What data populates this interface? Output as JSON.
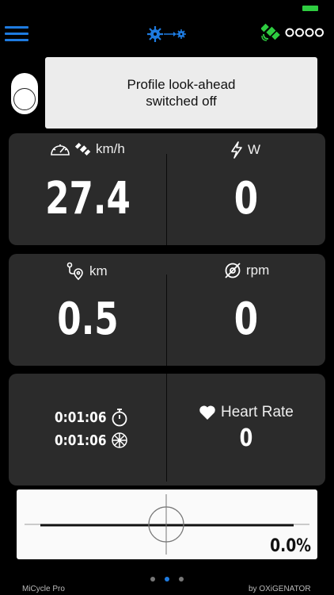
{
  "colors": {
    "accent": "#1e7be0",
    "gps": "#2ecc40",
    "panel": "#2b2b2b",
    "background": "#000000"
  },
  "status": {
    "battery_color": "#2ecc40"
  },
  "header": {
    "menu_icon": "hamburger-icon",
    "center_icon": "chainring-gear-icon",
    "gps_icon": "satellite-icon",
    "sensor_icon": "sensor-dots-icon"
  },
  "profile": {
    "switch_state": "off",
    "message_line1": "Profile look-ahead",
    "message_line2": "switched off"
  },
  "speed": {
    "unit": "km/h",
    "value": "27.4"
  },
  "power": {
    "unit": "W",
    "value": "0"
  },
  "distance": {
    "unit": "km",
    "value": "0.5"
  },
  "cadence": {
    "unit": "rpm",
    "value": "0"
  },
  "times": {
    "total": "0:01:06",
    "moving": "0:01:06"
  },
  "heart_rate": {
    "label": "Heart Rate",
    "value": "0"
  },
  "gradient": {
    "value": "0.0%"
  },
  "footer": {
    "app_name": "MiCycle Pro",
    "credit": "by OXiGENATOR"
  },
  "pager": {
    "count": 3,
    "active": 1
  }
}
